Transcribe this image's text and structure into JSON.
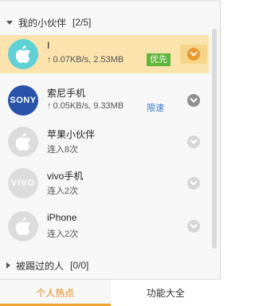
{
  "groups": {
    "partners": {
      "title": "我的小伙伴",
      "count": "[2/5]"
    },
    "kicked": {
      "title": "被踢过的人",
      "count": "[0/0]"
    }
  },
  "items": [
    {
      "name": "I",
      "arrow": "↑",
      "speed": "0.07KB/s, 2.53MB",
      "badge": "优先",
      "avatar": "apple-icon",
      "active": true
    },
    {
      "name": "索尼手机",
      "arrow": "↑",
      "speed": "0.05KB/s, 9.33MB",
      "badge": "限速",
      "avatar_text": "SONY",
      "avatar": "sony-logo"
    },
    {
      "name": "苹果小伙伴",
      "status": "连入8次",
      "avatar": "apple-icon"
    },
    {
      "name": "vivo手机",
      "status": "连入2次",
      "avatar_text": "VIVO",
      "avatar": "vivo-logo"
    },
    {
      "name": "iPhone",
      "status": "连入2次",
      "avatar": "apple-icon"
    }
  ],
  "tabs": {
    "hotspot": "个人热点",
    "features": "功能大全"
  },
  "colors": {
    "active_row": "#fbe3ad",
    "accent_orange": "#e89a2e",
    "badge_green": "#5fb43a",
    "link_blue": "#3a7bc8",
    "sony_blue": "#2853a7"
  }
}
